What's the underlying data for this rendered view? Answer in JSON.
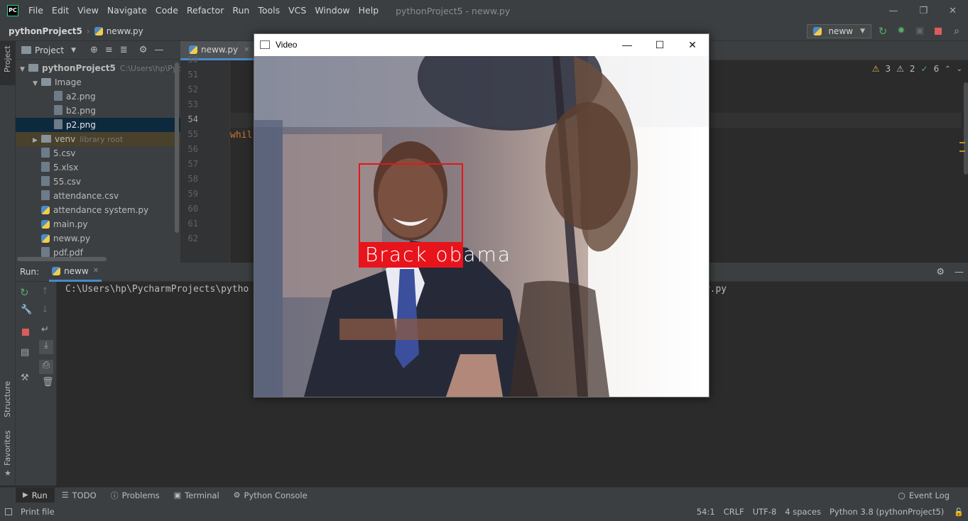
{
  "app": {
    "logo_text": "PC",
    "window_title": "pythonProject5 - neww.py"
  },
  "menu": [
    "File",
    "Edit",
    "View",
    "Navigate",
    "Code",
    "Refactor",
    "Run",
    "Tools",
    "VCS",
    "Window",
    "Help"
  ],
  "nav": {
    "project": "pythonProject5",
    "file": "neww.py",
    "run_config": "neww"
  },
  "left_stripe": {
    "project": "Project",
    "structure": "Structure",
    "favorites": "Favorites"
  },
  "project_panel": {
    "title": "Project",
    "tree": [
      {
        "label": "pythonProject5",
        "hint": "C:\\Users\\hp\\Pycha",
        "kind": "folder",
        "depth": 0,
        "expanded": true
      },
      {
        "label": "Image",
        "hint": "",
        "kind": "folder",
        "depth": 1,
        "expanded": true
      },
      {
        "label": "a2.png",
        "hint": "",
        "kind": "file",
        "depth": 2
      },
      {
        "label": "b2.png",
        "hint": "",
        "kind": "file",
        "depth": 2
      },
      {
        "label": "p2.png",
        "hint": "",
        "kind": "file",
        "depth": 2,
        "selected": true
      },
      {
        "label": "venv",
        "hint": "library root",
        "kind": "folder",
        "depth": 1,
        "collapsed": true,
        "excluded": true
      },
      {
        "label": "5.csv",
        "hint": "",
        "kind": "file",
        "depth": 1
      },
      {
        "label": "5.xlsx",
        "hint": "",
        "kind": "file",
        "depth": 1
      },
      {
        "label": "55.csv",
        "hint": "",
        "kind": "file",
        "depth": 1
      },
      {
        "label": "attendance.csv",
        "hint": "",
        "kind": "file",
        "depth": 1
      },
      {
        "label": "attendance system.py",
        "hint": "",
        "kind": "py",
        "depth": 1
      },
      {
        "label": "main.py",
        "hint": "",
        "kind": "py",
        "depth": 1
      },
      {
        "label": "neww.py",
        "hint": "",
        "kind": "py",
        "depth": 1
      },
      {
        "label": "pdf.pdf",
        "hint": "",
        "kind": "file",
        "depth": 1
      }
    ]
  },
  "editor": {
    "tab": "neww.py",
    "line_numbers": [
      "50",
      "51",
      "52",
      "53",
      "54",
      "55",
      "56",
      "57",
      "58",
      "59",
      "60",
      "61",
      "62"
    ],
    "code_line_55": "whil",
    "inspections": {
      "warnings": "3",
      "weak": "2",
      "ok": "6"
    }
  },
  "run_panel": {
    "label": "Run:",
    "tab": "neww",
    "console_left": "C:\\Users\\hp\\PycharmProjects\\pytho",
    "console_right": "ew.py"
  },
  "tool_windows": [
    "Run",
    "TODO",
    "Problems",
    "Terminal",
    "Python Console"
  ],
  "event_log": "Event Log",
  "status": {
    "left": "Print file",
    "position": "54:1",
    "line_sep": "CRLF",
    "encoding": "UTF-8",
    "indent": "4 spaces",
    "interpreter": "Python 3.8 (pythonProject5)"
  },
  "video": {
    "title": "Video",
    "face_label": "Brack obama",
    "box_color": "#e8141c"
  }
}
